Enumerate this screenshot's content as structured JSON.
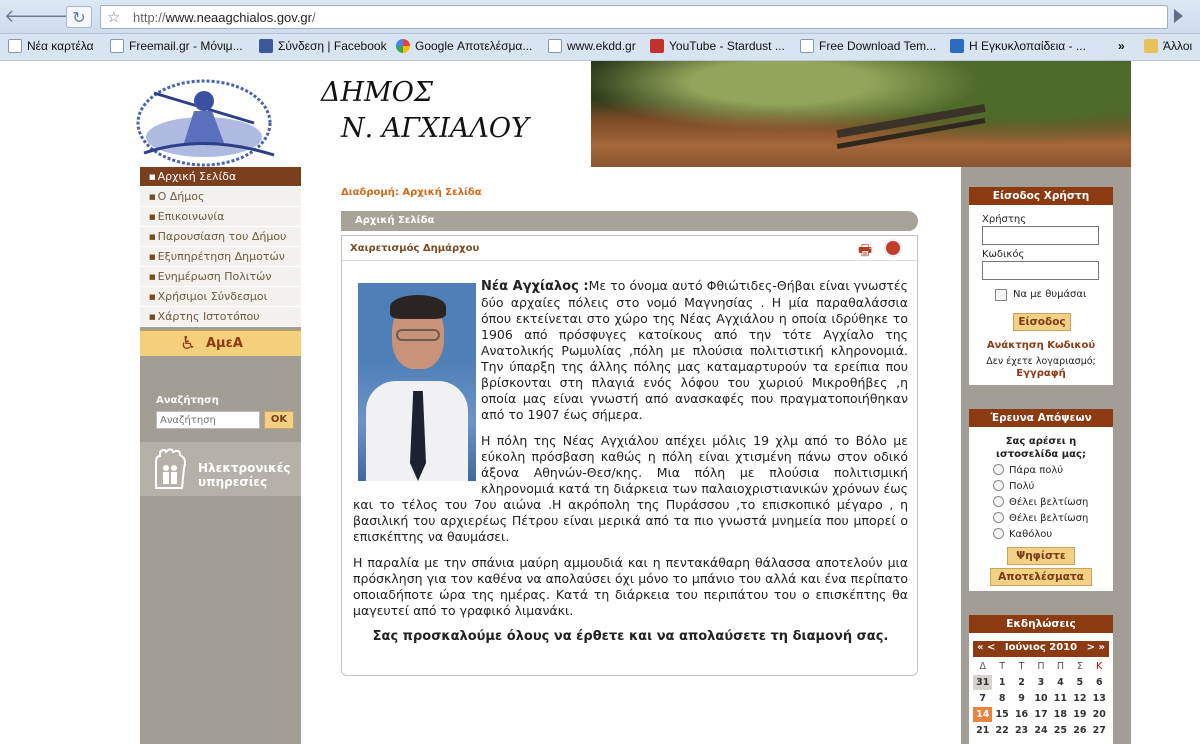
{
  "browser": {
    "url_prefix": "http://",
    "url_domain": "www.neaagchialos.gov.gr",
    "url_suffix": "/",
    "bookmarks": [
      {
        "label": "Νέα καρτέλα",
        "icon": "page"
      },
      {
        "label": "Freemail.gr - Μόνιμ...",
        "icon": "page"
      },
      {
        "label": "Σύνδεση | Facebook",
        "icon": "fb"
      },
      {
        "label": "Google Αποτελέσμα...",
        "icon": "gg"
      },
      {
        "label": "www.ekdd.gr",
        "icon": "page"
      },
      {
        "label": "YouTube - Stardust ...",
        "icon": "yt"
      },
      {
        "label": "Free Download Tem...",
        "icon": "page"
      },
      {
        "label": "Η Εγκυκλοπαίδεια - ...",
        "icon": "wiki"
      },
      {
        "label": "Άλλοι",
        "icon": "folder"
      }
    ],
    "overflow": "»"
  },
  "header": {
    "title_line1": "ΔΗΜΟΣ",
    "title_line2": "Ν. ΑΓΧΙΑΛΟΥ"
  },
  "menu": [
    "Αρχική Σελίδα",
    "Ο Δήμος",
    "Επικοινωνία",
    "Παρουσίαση του Δήμου",
    "Εξυπηρέτηση Δημοτών",
    "Ενημέρωση Πολιτών",
    "Χρήσιμοι Σύνδεσμοι",
    "Χάρτης Ιστοτόπου"
  ],
  "amea": "ΑμεΑ",
  "search": {
    "title": "Αναζήτηση",
    "placeholder": "Αναζήτηση",
    "button": "OK"
  },
  "eservices": {
    "line1": "Ηλεκτρονικές",
    "line2": "υπηρεσίες"
  },
  "breadcrumb": "Διαδρομή: Αρχική Σελίδα",
  "section_title": "Αρχική Σελίδα",
  "article": {
    "title": "Χαιρετισμός Δημάρχου",
    "lead": "Νέα Αγχίαλος :",
    "p1": "Με το όνομα αυτό Φθιώτιδες-Θήβαι είναι γνωστές δύο αρχαίες πόλεις στο νομό Μαγνησίας . Η μία παραθαλάσσια όπου εκτείνεται στο χώρο της Νέας Αγχιάλου η οποία ιδρύθηκε το 1906 από πρόσφυγες κατοίκους από την τότε Αγχίαλο της Ανατολικής Ρωμυλίας ,πόλη με πλούσια πολιτιστική κληρονομιά. Την ύπαρξη της άλλης πόλης μας καταμαρτυρούν τα ερείπια που βρίσκονται στη πλαγιά ενός λόφου του χωριού Μικροθήβες ,η οποία μας είναι γνωστή από ανασκαφές που πραγματοποιήθηκαν από το 1907 έως σήμερα.",
    "p2": "Η πόλη της Νέας Αγχιάλου απέχει μόλις 19 χλμ από το Βόλο με εύκολη πρόσβαση καθώς η πόλη είναι χτισμένη πάνω στον οδικό άξονα Αθηνών-Θεσ/κης. Μια πόλη με πλούσια πολιτισμική κληρονομιά κατά τη διάρκεια των παλαιοχριστιανικών χρόνων έως και το τέλος του 7ου αιώνα .Η ακρόπολη της Πυράσσου ,το επισκοπικό μέγαρο , η βασιλική του αρχιερέως Πέτρου είναι μερικά από τα πιο γνωστά μνημεία που μπορεί ο επισκέπτης να θαυμάσει.",
    "p3": "Η παραλία με την σπάνια μαύρη αμμουδιά και η πεντακάθαρη θάλασσα αποτελούν μια πρόσκληση για τον καθένα να απολαύσει όχι μόνο το μπάνιο του αλλά και ένα περίπατο οποιαδήποτε ώρα της ημέρας. Κατά τη διάρκεια του περιπάτου του ο επισκέπτης θα μαγευτεί από το γραφικό λιμανάκι.",
    "closing": "Σας προσκαλούμε όλους να έρθετε και να απολαύσετε τη διαμονή σας."
  },
  "login": {
    "title": "Είσοδος Χρήστη",
    "user_label": "Χρήστης",
    "pass_label": "Κωδικός",
    "remember": "Να με θυμάσαι",
    "button": "Είσοδος",
    "forgot": "Ανάκτηση Κωδικού",
    "no_account": "Δεν έχετε λογαριασμό;",
    "register": "Εγγραφή"
  },
  "poll": {
    "title": "Έρευνα Απόψεων",
    "question": "Σας αρέσει η ιστοσελίδα μας;",
    "options": [
      "Πάρα πολύ",
      "Πολύ",
      "Θέλει βελτίωση",
      "Θέλει βελτίωση",
      "Καθόλου"
    ],
    "vote": "Ψηφίστε",
    "results": "Αποτελέσματα"
  },
  "events": {
    "title": "Εκδηλώσεις",
    "prev": "« <",
    "month": "Ιούνιος 2010",
    "next": "> »",
    "weekdays": [
      "Δ",
      "Τ",
      "Τ",
      "Π",
      "Π",
      "Σ",
      "Κ"
    ],
    "weeks": [
      [
        "31",
        "1",
        "2",
        "3",
        "4",
        "5",
        "6"
      ],
      [
        "7",
        "8",
        "9",
        "10",
        "11",
        "12",
        "13"
      ],
      [
        "14",
        "15",
        "16",
        "17",
        "18",
        "19",
        "20"
      ],
      [
        "21",
        "22",
        "23",
        "24",
        "25",
        "26",
        "27"
      ]
    ],
    "today": "14"
  }
}
